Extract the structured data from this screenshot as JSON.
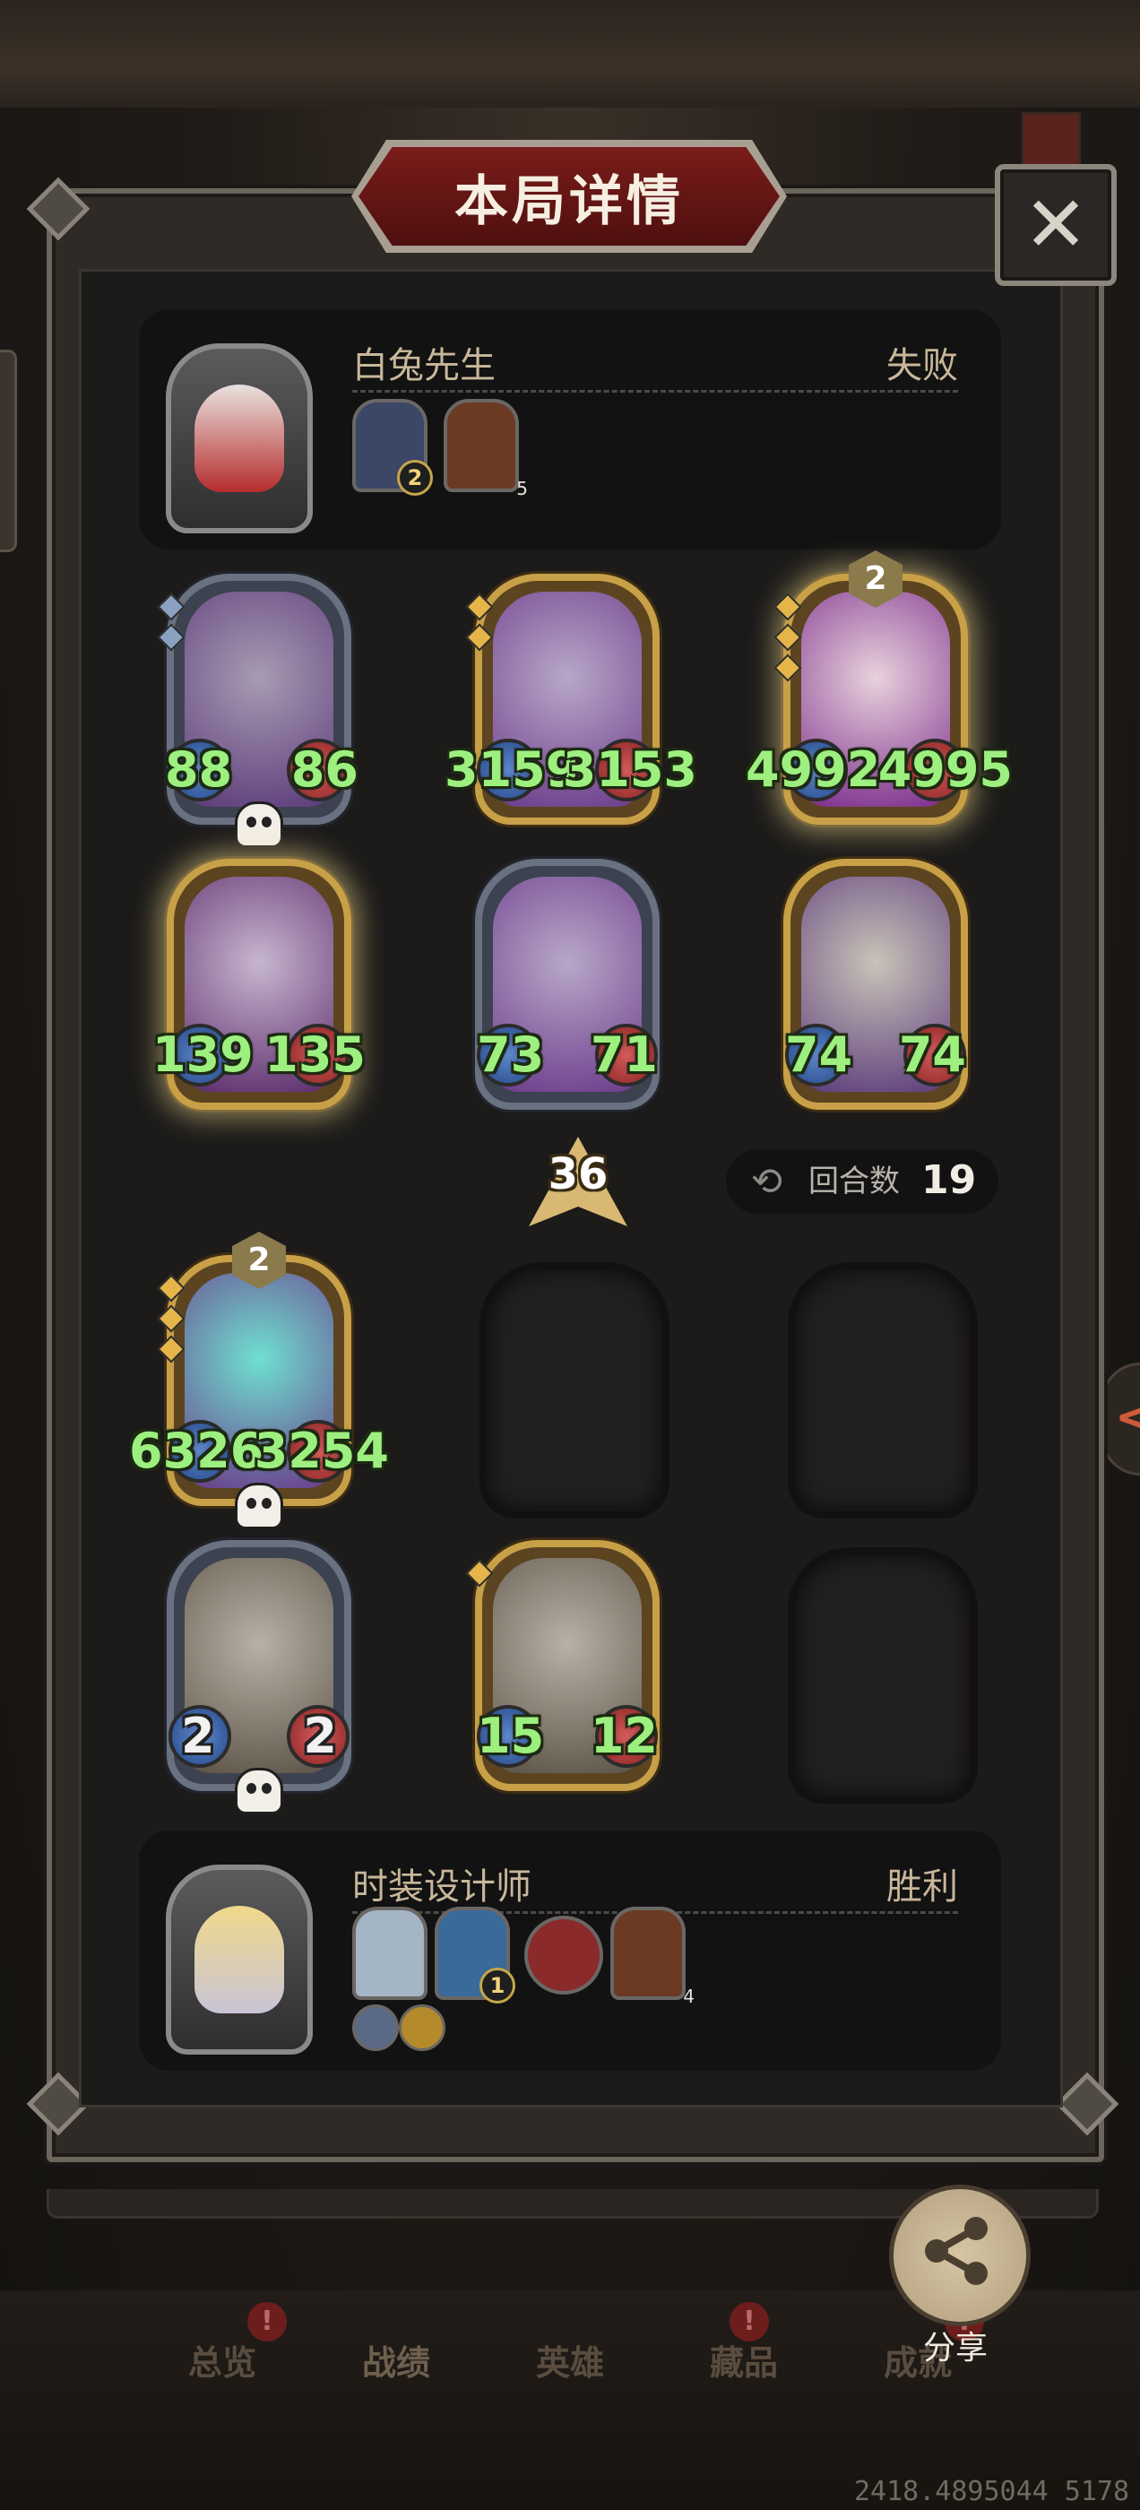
{
  "title": "本局详情",
  "close_symbol": "✕",
  "player_top": {
    "name": "白兔先生",
    "result": "失败",
    "chips": [
      {
        "icon": "clock-artifact-icon",
        "badge": "2"
      },
      {
        "icon": "house-icon",
        "sub": "5"
      }
    ]
  },
  "player_bottom": {
    "name": "时装设计师",
    "result": "胜利",
    "chips": [
      {
        "icon": "tailor-mannequin-icon"
      },
      {
        "icon": "blue-card-icon",
        "badge": "1"
      },
      {
        "icon": "hooded-figure-icon"
      },
      {
        "icon": "house-icon",
        "sub": "4"
      }
    ],
    "small_chips": [
      {
        "icon": "crossed-swords-icon"
      },
      {
        "icon": "golden-horse-icon"
      }
    ]
  },
  "board_top": [
    {
      "name": "robot-bell",
      "frame": "silver",
      "attack": "88",
      "health": "86",
      "skull": true,
      "pips": [
        "silver",
        "silver"
      ]
    },
    {
      "name": "airship",
      "frame": "gold",
      "attack": "3159",
      "health": "3153",
      "pips": [
        "gold",
        "gold"
      ]
    },
    {
      "name": "clown",
      "frame": "gold",
      "attack": "4992",
      "health": "4995",
      "tier": "2",
      "glow": true,
      "pips": [
        "gold",
        "gold",
        "gold"
      ]
    },
    {
      "name": "demon-girl",
      "frame": "gold",
      "attack": "139",
      "health": "135",
      "glow": true
    },
    {
      "name": "airship",
      "frame": "silver",
      "attack": "73",
      "health": "71"
    },
    {
      "name": "horned-beast",
      "frame": "gold",
      "attack": "74",
      "health": "74"
    }
  ],
  "level": "36",
  "round": {
    "label": "回合数",
    "value": "19",
    "icon": "refresh-icon"
  },
  "board_bottom": [
    {
      "name": "spirit-wolf",
      "frame": "gold",
      "attack": "6326",
      "health": "3254",
      "tier": "2",
      "skull": true,
      "pips": [
        "gold",
        "gold",
        "gold"
      ]
    },
    {
      "name": "robot-bell",
      "frame": "silver",
      "attack": "2",
      "health": "2",
      "skull": true,
      "white": true
    },
    {
      "name": "airship",
      "frame": "gold",
      "attack": "15",
      "health": "12",
      "pips": [
        "gold"
      ]
    }
  ],
  "nav": [
    "总览",
    "战绩",
    "英雄",
    "藏品",
    "成就"
  ],
  "nav_dots": [
    "!",
    "!",
    "!"
  ],
  "share_label": "分享",
  "footer_id": "2418.4895044 5178"
}
